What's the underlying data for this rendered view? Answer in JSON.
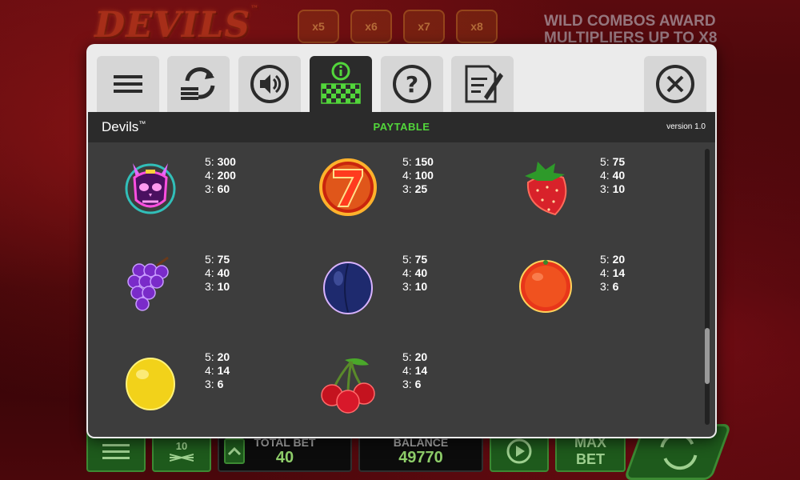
{
  "background": {
    "logo": "DEVILS",
    "logo_tm": "™",
    "multipliers": [
      "x5",
      "x6",
      "x7",
      "x8"
    ],
    "promo_line1": "WILD COMBOS AWARD",
    "promo_line2": "MULTIPLIERS UP TO X8",
    "bottom_bar": {
      "lines_value": "10",
      "total_bet_label": "TOTAL BET",
      "total_bet_value": "40",
      "balance_label": "BALANCE",
      "balance_value": "49770",
      "max_bet_line1": "MAX",
      "max_bet_line2": "BET"
    }
  },
  "modal": {
    "game_title": "Devils",
    "game_title_tm": "™",
    "section_title": "PAYTABLE",
    "version": "version 1.0",
    "tabs": [
      {
        "icon": "menu-icon",
        "active": false
      },
      {
        "icon": "autoplay-icon",
        "active": false
      },
      {
        "icon": "sound-icon",
        "active": false
      },
      {
        "icon": "paytable-icon",
        "active": true
      },
      {
        "icon": "help-icon",
        "active": false
      },
      {
        "icon": "history-icon",
        "active": false
      }
    ],
    "close_icon": "close-icon",
    "accent_color": "#52d63b"
  },
  "paytable": [
    {
      "symbol": "devil-skull",
      "pays": [
        {
          "k": "5:",
          "v": "300"
        },
        {
          "k": "4:",
          "v": "200"
        },
        {
          "k": "3:",
          "v": "60"
        }
      ]
    },
    {
      "symbol": "seven",
      "pays": [
        {
          "k": "5:",
          "v": "150"
        },
        {
          "k": "4:",
          "v": "100"
        },
        {
          "k": "3:",
          "v": "25"
        }
      ]
    },
    {
      "symbol": "strawberry",
      "pays": [
        {
          "k": "5:",
          "v": "75"
        },
        {
          "k": "4:",
          "v": "40"
        },
        {
          "k": "3:",
          "v": "10"
        }
      ]
    },
    {
      "symbol": "grapes",
      "pays": [
        {
          "k": "5:",
          "v": "75"
        },
        {
          "k": "4:",
          "v": "40"
        },
        {
          "k": "3:",
          "v": "10"
        }
      ]
    },
    {
      "symbol": "plum",
      "pays": [
        {
          "k": "5:",
          "v": "75"
        },
        {
          "k": "4:",
          "v": "40"
        },
        {
          "k": "3:",
          "v": "10"
        }
      ]
    },
    {
      "symbol": "orange",
      "pays": [
        {
          "k": "5:",
          "v": "20"
        },
        {
          "k": "4:",
          "v": "14"
        },
        {
          "k": "3:",
          "v": "6"
        }
      ]
    },
    {
      "symbol": "lemon",
      "pays": [
        {
          "k": "5:",
          "v": "20"
        },
        {
          "k": "4:",
          "v": "14"
        },
        {
          "k": "3:",
          "v": "6"
        }
      ]
    },
    {
      "symbol": "cherries",
      "pays": [
        {
          "k": "5:",
          "v": "20"
        },
        {
          "k": "4:",
          "v": "14"
        },
        {
          "k": "3:",
          "v": "6"
        }
      ]
    }
  ]
}
